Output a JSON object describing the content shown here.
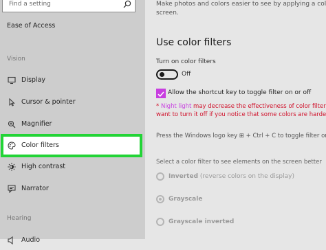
{
  "search": {
    "placeholder": "Find a setting"
  },
  "sidebar": {
    "title": "Ease of Access",
    "section_vision": "Vision",
    "items": [
      {
        "label": "Display",
        "icon": "display-icon"
      },
      {
        "label": "Cursor & pointer",
        "icon": "cursor-icon"
      },
      {
        "label": "Magnifier",
        "icon": "magnifier-icon"
      },
      {
        "label": "Color filters",
        "icon": "palette-icon"
      },
      {
        "label": "High contrast",
        "icon": "contrast-icon"
      },
      {
        "label": "Narrator",
        "icon": "narrator-icon"
      }
    ],
    "section_hearing": "Hearing",
    "cut_item": "Audio"
  },
  "main": {
    "intro_line1": "Make photos and colors easier to see by applying a color filt",
    "intro_line2": "screen.",
    "heading": "Use color filters",
    "toggle_label": "Turn on color filters",
    "toggle_state": "Off",
    "shortcut_label": "Allow the shortcut key to toggle filter on or off",
    "warning_asterisk": "*",
    "warning_link": "Night light",
    "warning_rest": "may decrease the effectiveness of color filters.",
    "warning_line2": "want to turn it off if you notice that some colors are harder to",
    "shortcut_hint": "Press the Windows logo key ⊞ + Ctrl + C to toggle filter on or",
    "select_prompt": "Select a color filter to see elements on the screen better",
    "filters": [
      {
        "name": "Inverted",
        "desc": "(reverse colors on the display)"
      },
      {
        "name": "Grayscale",
        "desc": ""
      },
      {
        "name": "Grayscale inverted",
        "desc": ""
      }
    ]
  },
  "colors": {
    "highlight": "#22d436",
    "accent": "#c83fe0",
    "warning": "#d0102a"
  }
}
